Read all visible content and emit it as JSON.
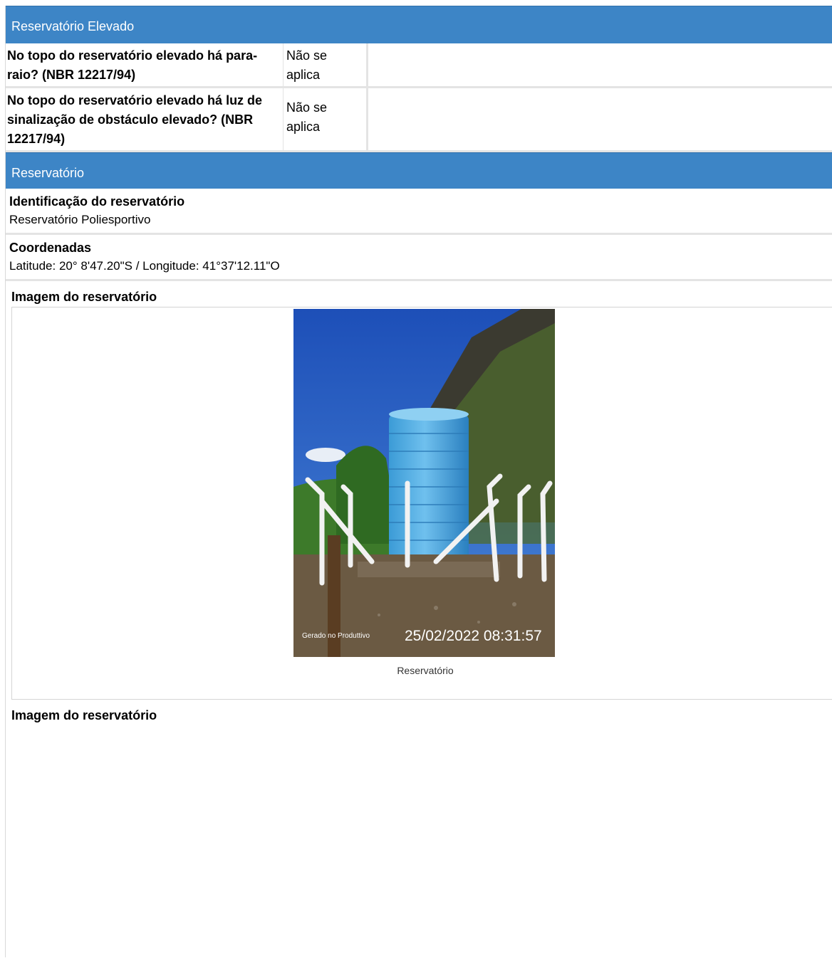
{
  "sections": {
    "elevated": {
      "title": "Reservatório Elevado",
      "questions": [
        {
          "question": "No topo do reservatório elevado há para-raio? (NBR 12217/94)",
          "answer": "Não se aplica"
        },
        {
          "question": "No topo do reservatório elevado há luz de sinalização de obstáculo elevado? (NBR 12217/94)",
          "answer": "Não se aplica"
        }
      ]
    },
    "reservoir": {
      "title": "Reservatório",
      "identification": {
        "label": "Identificação do reservatório",
        "value": "Reservatório Poliesportivo"
      },
      "coordinates": {
        "label": "Coordenadas",
        "value": "Latitude: 20° 8'47.20\"S / Longitude: 41°37'12.11\"O"
      },
      "image1": {
        "label": "Imagem do reservatório",
        "caption": "Reservatório",
        "watermark_left": "Gerado no Produttivo",
        "watermark_timestamp": "25/02/2022 08:31:57"
      },
      "image2": {
        "label": "Imagem do reservatório"
      }
    }
  },
  "colors": {
    "header": "#3d85c6",
    "border": "#e4e4e4"
  }
}
